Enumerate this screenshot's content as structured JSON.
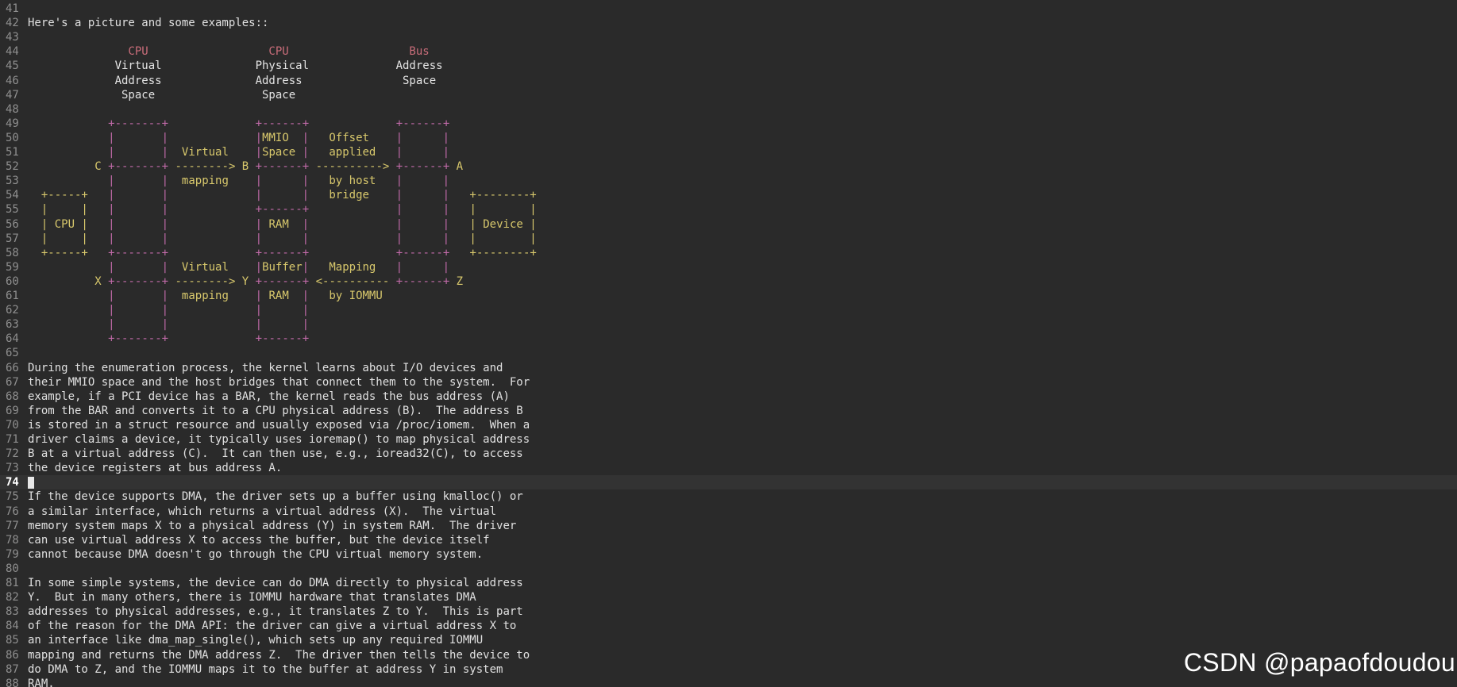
{
  "editor": {
    "colors": {
      "background": "#2a2a2a",
      "current_line": "#333333",
      "line_number": "#8f8f8f",
      "text": "#e0e0e0",
      "diagram_text": "#d8c86c",
      "diagram_border": "#c06aa8",
      "diagram_header": "#c96d7a"
    },
    "cursor_line": "74",
    "lines": [
      {
        "n": "41",
        "text": ""
      },
      {
        "n": "42",
        "text": "Here's a picture and some examples::"
      },
      {
        "n": "43",
        "text": ""
      },
      {
        "n": "44",
        "text": "               CPU                  CPU                  Bus"
      },
      {
        "n": "45",
        "text": "             Virtual              Physical             Address"
      },
      {
        "n": "46",
        "text": "             Address              Address               Space"
      },
      {
        "n": "47",
        "text": "              Space                Space"
      },
      {
        "n": "48",
        "text": ""
      },
      {
        "n": "49",
        "text": "            +-------+             +------+             +------+"
      },
      {
        "n": "50",
        "text": "            |       |             |MMIO  |   Offset    |      |"
      },
      {
        "n": "51",
        "text": "            |       |  Virtual    |Space |   applied   |      |"
      },
      {
        "n": "52",
        "text": "          C +-------+ --------> B +------+ ----------> +------+ A"
      },
      {
        "n": "53",
        "text": "            |       |  mapping    |      |   by host   |      |"
      },
      {
        "n": "54",
        "text": "  +-----+   |       |             |      |   bridge    |      |   +--------+"
      },
      {
        "n": "55",
        "text": "  |     |   |       |             +------+             |      |   |        |"
      },
      {
        "n": "56",
        "text": "  | CPU |   |       |             | RAM  |             |      |   | Device |"
      },
      {
        "n": "57",
        "text": "  |     |   |       |             |      |             |      |   |        |"
      },
      {
        "n": "58",
        "text": "  +-----+   +-------+             +------+             +------+   +--------+"
      },
      {
        "n": "59",
        "text": "            |       |  Virtual    |Buffer|   Mapping   |      |"
      },
      {
        "n": "60",
        "text": "          X +-------+ --------> Y +------+ <---------- +------+ Z"
      },
      {
        "n": "61",
        "text": "            |       |  mapping    | RAM  |   by IOMMU"
      },
      {
        "n": "62",
        "text": "            |       |             |      |"
      },
      {
        "n": "63",
        "text": "            |       |             |      |"
      },
      {
        "n": "64",
        "text": "            +-------+             +------+"
      },
      {
        "n": "65",
        "text": ""
      },
      {
        "n": "66",
        "text": "During the enumeration process, the kernel learns about I/O devices and"
      },
      {
        "n": "67",
        "text": "their MMIO space and the host bridges that connect them to the system.  For"
      },
      {
        "n": "68",
        "text": "example, if a PCI device has a BAR, the kernel reads the bus address (A)"
      },
      {
        "n": "69",
        "text": "from the BAR and converts it to a CPU physical address (B).  The address B"
      },
      {
        "n": "70",
        "text": "is stored in a struct resource and usually exposed via /proc/iomem.  When a"
      },
      {
        "n": "71",
        "text": "driver claims a device, it typically uses ioremap() to map physical address"
      },
      {
        "n": "72",
        "text": "B at a virtual address (C).  It can then use, e.g., ioread32(C), to access"
      },
      {
        "n": "73",
        "text": "the device registers at bus address A."
      },
      {
        "n": "74",
        "text": ""
      },
      {
        "n": "75",
        "text": "If the device supports DMA, the driver sets up a buffer using kmalloc() or"
      },
      {
        "n": "76",
        "text": "a similar interface, which returns a virtual address (X).  The virtual"
      },
      {
        "n": "77",
        "text": "memory system maps X to a physical address (Y) in system RAM.  The driver"
      },
      {
        "n": "78",
        "text": "can use virtual address X to access the buffer, but the device itself"
      },
      {
        "n": "79",
        "text": "cannot because DMA doesn't go through the CPU virtual memory system."
      },
      {
        "n": "80",
        "text": ""
      },
      {
        "n": "81",
        "text": "In some simple systems, the device can do DMA directly to physical address"
      },
      {
        "n": "82",
        "text": "Y.  But in many others, there is IOMMU hardware that translates DMA"
      },
      {
        "n": "83",
        "text": "addresses to physical addresses, e.g., it translates Z to Y.  This is part"
      },
      {
        "n": "84",
        "text": "of the reason for the DMA API: the driver can give a virtual address X to"
      },
      {
        "n": "85",
        "text": "an interface like dma_map_single(), which sets up any required IOMMU"
      },
      {
        "n": "86",
        "text": "mapping and returns the DMA address Z.  The driver then tells the device to"
      },
      {
        "n": "87",
        "text": "do DMA to Z, and the IOMMU maps it to the buffer at address Y in system"
      },
      {
        "n": "88",
        "text": "RAM."
      }
    ]
  },
  "watermark": "CSDN @papaofdoudou"
}
